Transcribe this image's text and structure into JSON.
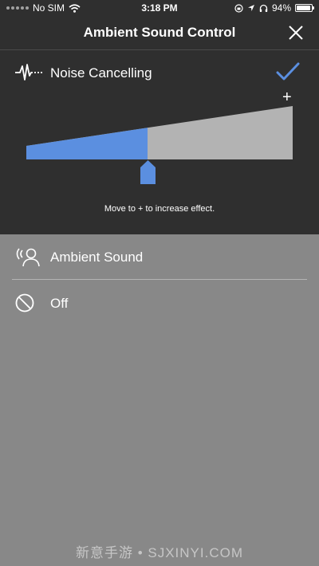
{
  "status_bar": {
    "carrier": "No SIM",
    "time": "3:18 PM",
    "battery": "94%",
    "battery_level": 0.94,
    "icons": [
      "signal-dots-icon",
      "wifi-icon",
      "orientation-lock-icon",
      "location-icon",
      "headphones-icon",
      "battery-icon"
    ]
  },
  "header": {
    "title": "Ambient Sound Control",
    "close_icon": "close-icon"
  },
  "noise_cancelling": {
    "label": "Noise Cancelling",
    "selected": true,
    "icon": "noise-wave-icon",
    "check_icon": "checkmark-icon"
  },
  "effect_slider": {
    "plus_label": "+",
    "level": 0.455,
    "hint": "Move to + to increase effect."
  },
  "options": [
    {
      "label": "Ambient Sound",
      "icon": "ambient-sound-icon"
    },
    {
      "label": "Off",
      "icon": "off-icon"
    }
  ],
  "watermark": "新意手游 • SJXINYI.COM",
  "colors": {
    "accent": "#5b8fe0",
    "top_panel": "#2f2f2f",
    "bottom_panel": "#888888",
    "slider_track": "#b3b3b3"
  }
}
